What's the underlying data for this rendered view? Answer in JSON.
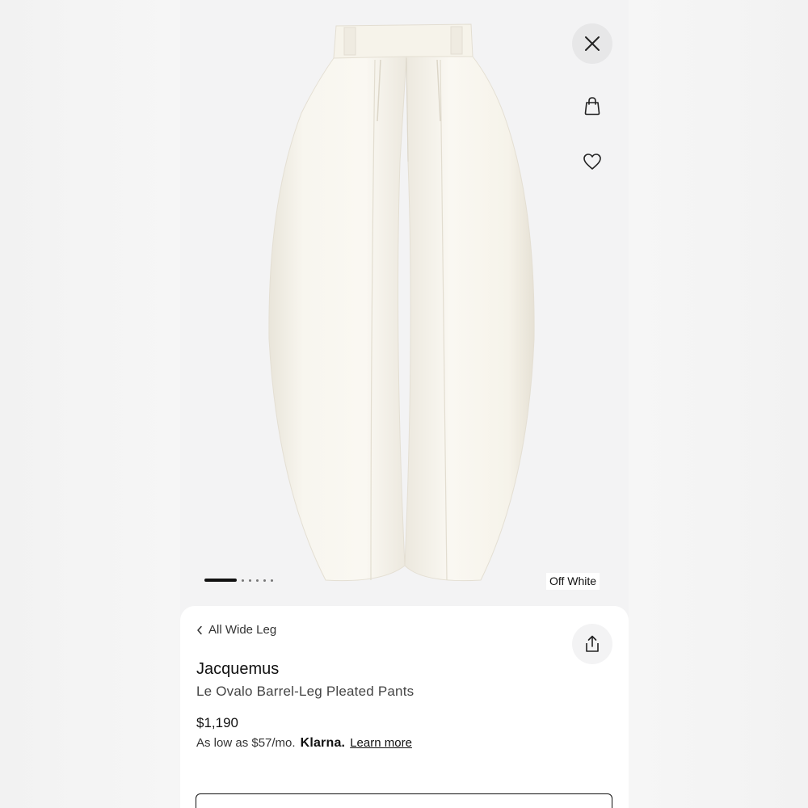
{
  "product": {
    "image_alt": "Off White barrel-leg pleated pants",
    "color_label": "Off White",
    "carousel": {
      "total": 6,
      "active_index": 0
    }
  },
  "header_icons": {
    "close": "close-icon",
    "bag": "shopping-bag-icon",
    "favorite": "heart-icon",
    "share": "share-icon"
  },
  "breadcrumb": {
    "label": "All Wide Leg"
  },
  "details": {
    "brand": "Jacquemus",
    "name": "Le Ovalo Barrel-Leg Pleated Pants",
    "price": "$1,190",
    "installment": "As low as $57/mo.",
    "klarna": "Klarna.",
    "learn_more": "Learn more"
  },
  "colors": {
    "background": "#f3f3f4",
    "sheet": "#ffffff",
    "text": "#111111",
    "garment": "#f7f4ec"
  }
}
